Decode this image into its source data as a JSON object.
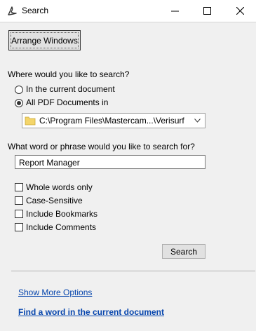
{
  "window": {
    "title": "Search",
    "icons": {
      "app": "acrobat-icon",
      "minimize": "minimize-icon",
      "maximize": "maximize-icon",
      "close": "close-icon"
    }
  },
  "toolbar": {
    "arrange_label": "Arrange Windows"
  },
  "where": {
    "prompt": "Where would you like to search?",
    "options": [
      {
        "label": "In the current document",
        "selected": false
      },
      {
        "label": "All PDF Documents in",
        "selected": true
      }
    ],
    "folder": "C:\\Program Files\\Mastercam...\\Verisurf"
  },
  "what": {
    "prompt": "What word or phrase would you like to search for?",
    "value": "Report Manager"
  },
  "options": [
    {
      "label": "Whole words only",
      "checked": false
    },
    {
      "label": "Case-Sensitive",
      "checked": false
    },
    {
      "label": "Include Bookmarks",
      "checked": false
    },
    {
      "label": "Include Comments",
      "checked": false
    }
  ],
  "search_label": "Search",
  "links": {
    "more_options": "Show More Options",
    "find_word": "Find a word in the current document"
  },
  "colors": {
    "link": "#0645ad",
    "background": "#f0f0f0",
    "folder": "#f4d56a"
  }
}
